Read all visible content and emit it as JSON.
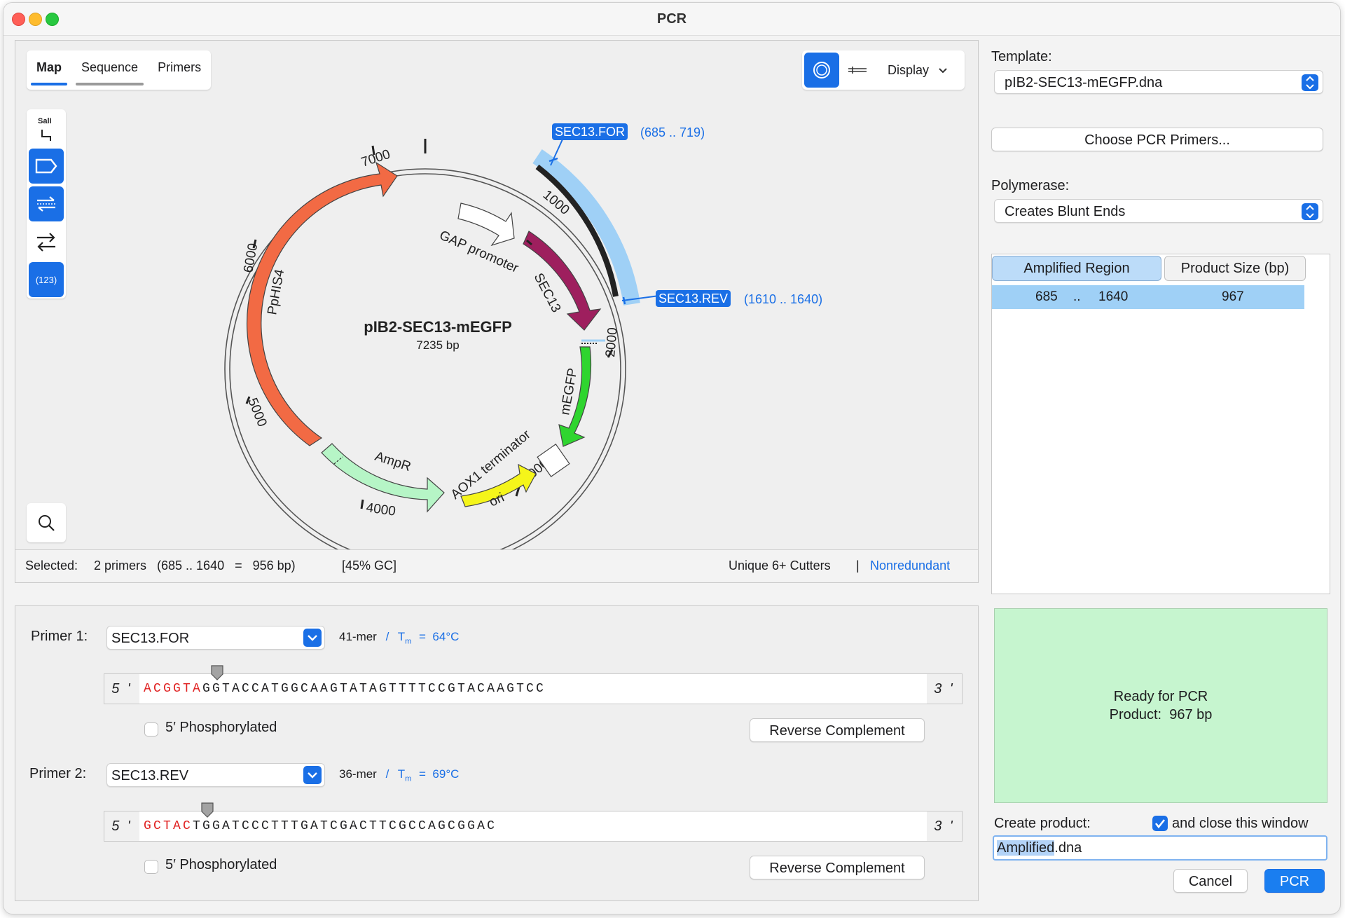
{
  "window": {
    "title": "PCR"
  },
  "view_tabs": [
    {
      "label": "Map"
    },
    {
      "label": "Sequence"
    },
    {
      "label": "Primers"
    }
  ],
  "tools": {
    "enzyme_label": "SalI",
    "numbers_label": "(123)"
  },
  "display_menu": {
    "label": "Display"
  },
  "map": {
    "plasmid_name": "pIB2-SEC13-mEGFP",
    "plasmid_length": "7235 bp",
    "ticks": [
      "1000",
      "2000",
      "3000",
      "4000",
      "5000",
      "6000",
      "7000"
    ],
    "features": [
      "GAP promoter",
      "SEC13",
      "mEGFP",
      "AOX1 terminator",
      "ori",
      "AmpR",
      "PpHIS4"
    ],
    "primers": [
      {
        "name": "SEC13.FOR",
        "range": "(685 .. 719)"
      },
      {
        "name": "SEC13.REV",
        "range": "(1610 .. 1640)"
      }
    ],
    "colors": {
      "PpHIS4": "#f26a44",
      "SEC13": "#9e1f5e",
      "mEGFP": "#2fd52f",
      "ori": "#f5f51a",
      "AmpR": "#b6f5c6",
      "amplified": "#9fd0f6"
    }
  },
  "status": {
    "selected_label": "Selected:",
    "selected_value": "2 primers   (685 .. 1640   =   956 bp)",
    "gc": "[45% GC]",
    "cutters": "Unique 6+ Cutters",
    "separator": "|",
    "nonredundant": "Nonredundant"
  },
  "primer1": {
    "label": "Primer 1:",
    "name": "SEC13.FOR",
    "length": "41-mer",
    "slash": "/",
    "tm_label": "T",
    "tm_sub": "m",
    "tm_value": "=  64°C",
    "five_prime": "5 '",
    "three_prime": "3 '",
    "seq_tail": "ACGGTA",
    "seq_body": "GGTACCATGGCAAGTATAGTTTTCCGTACAAGTCC",
    "phospho_label": "5′ Phosphorylated",
    "rc_label": "Reverse Complement"
  },
  "primer2": {
    "label": "Primer 2:",
    "name": "SEC13.REV",
    "length": "36-mer",
    "slash": "/",
    "tm_label": "T",
    "tm_sub": "m",
    "tm_value": "=  69°C",
    "five_prime": "5 '",
    "three_prime": "3 '",
    "seq_tail": "GCTAC",
    "seq_body": "TGGATCCCTTTGATCGACTTCGCCAGCGGAC",
    "phospho_label": "5′ Phosphorylated",
    "rc_label": "Reverse Complement"
  },
  "right": {
    "template_label": "Template:",
    "template_value": "pIB2-SEC13-mEGFP.dna",
    "choose_primers": "Choose PCR Primers...",
    "polymerase_label": "Polymerase:",
    "polymerase_value": "Creates Blunt Ends",
    "col_region": "Amplified Region",
    "col_size": "Product Size (bp)",
    "row_start": "685",
    "row_sep": "..",
    "row_end": "1640",
    "row_size": "967",
    "ready_line1": "Ready for PCR",
    "ready_line2": "Product:  967 bp",
    "create_label": "Create product:",
    "close_label": "and close this window",
    "filename_sel": "Amplified",
    "filename_ext": ".dna",
    "cancel": "Cancel",
    "pcr": "PCR"
  }
}
